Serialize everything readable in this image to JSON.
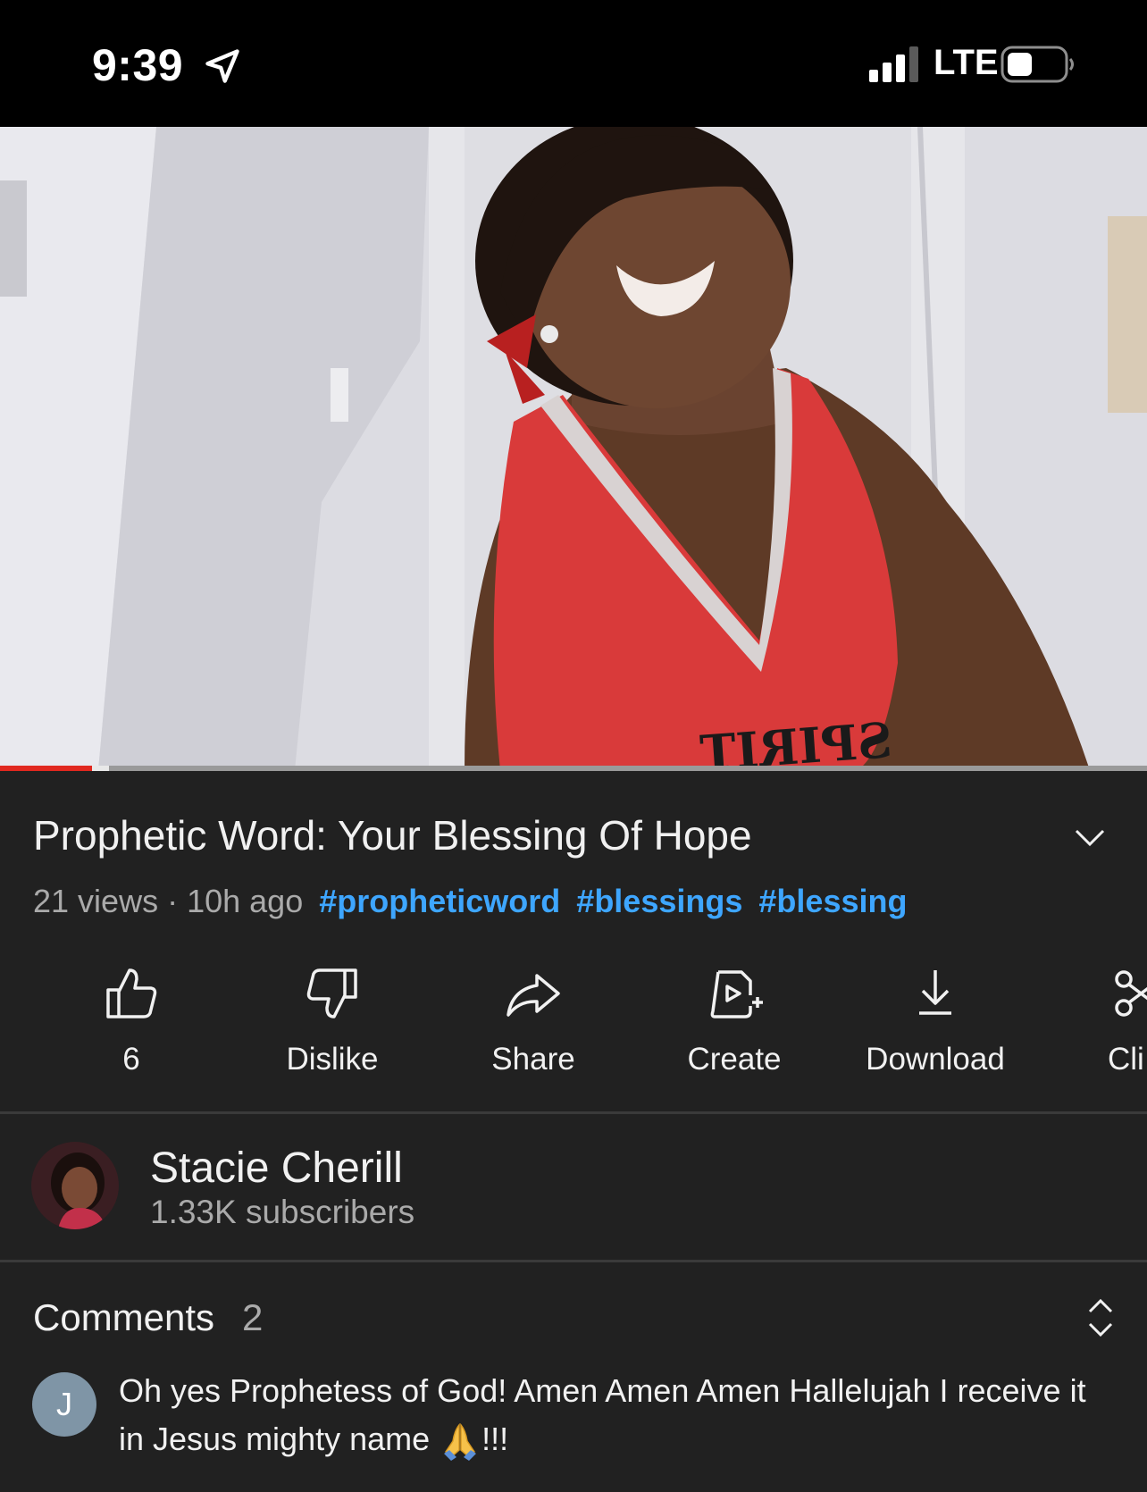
{
  "status_bar": {
    "time": "9:39",
    "network": "LTE",
    "icons": [
      "location-arrow-icon",
      "cellular-signal-icon",
      "battery-icon"
    ]
  },
  "player": {
    "progress_fraction": 0.08,
    "buffered_fraction": 0.095,
    "progress_color": "#e1281f",
    "shirt_text": "SPIRIT"
  },
  "video": {
    "title": "Prophetic Word: Your Blessing Of Hope",
    "views": "21 views",
    "separator": "·",
    "age": "10h ago",
    "hashtags": [
      "#propheticword",
      "#blessings",
      "#blessing"
    ],
    "hashtag_color": "#3ea6ff"
  },
  "actions": [
    {
      "label": "6",
      "icon": "thumbs-up-icon"
    },
    {
      "label": "Dislike",
      "icon": "thumbs-down-icon"
    },
    {
      "label": "Share",
      "icon": "share-arrow-icon"
    },
    {
      "label": "Create",
      "icon": "create-icon"
    },
    {
      "label": "Download",
      "icon": "download-icon"
    },
    {
      "label": "Cli",
      "icon": "scissors-icon"
    }
  ],
  "channel": {
    "name": "Stacie Cherill",
    "subscribers": "1.33K subscribers"
  },
  "comments": {
    "label": "Comments",
    "count": "2",
    "top_comment": {
      "avatar_letter": "J",
      "text_before": "Oh yes Prophetess of God! Amen Amen Amen Hallelujah I receive it in Jesus mighty name ",
      "emoji": "folded-hands-icon",
      "text_after": "!!!"
    }
  }
}
